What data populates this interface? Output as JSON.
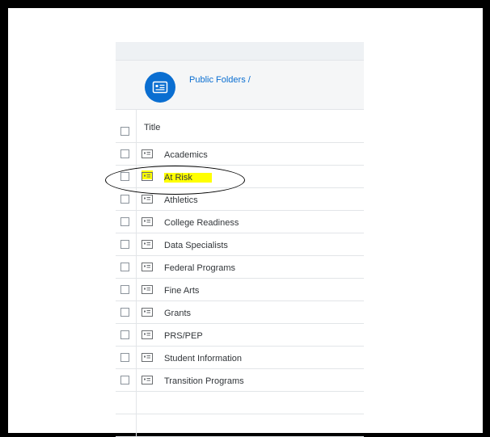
{
  "header": {
    "breadcrumb": "Public Folders /",
    "icon": "folder-card-icon",
    "accent_color": "#0a6ed1"
  },
  "table": {
    "column_title": "Title",
    "rows": [
      {
        "label": "Academics"
      },
      {
        "label": "At Risk",
        "highlighted": true
      },
      {
        "label": "Athletics"
      },
      {
        "label": "College Readiness"
      },
      {
        "label": "Data Specialists"
      },
      {
        "label": "Federal Programs"
      },
      {
        "label": "Fine Arts"
      },
      {
        "label": "Grants"
      },
      {
        "label": "PRS/PEP"
      },
      {
        "label": "Student Information"
      },
      {
        "label": "Transition Programs"
      }
    ]
  },
  "annotation": {
    "highlight_color": "#ffff00",
    "circled_item": "At Risk"
  }
}
